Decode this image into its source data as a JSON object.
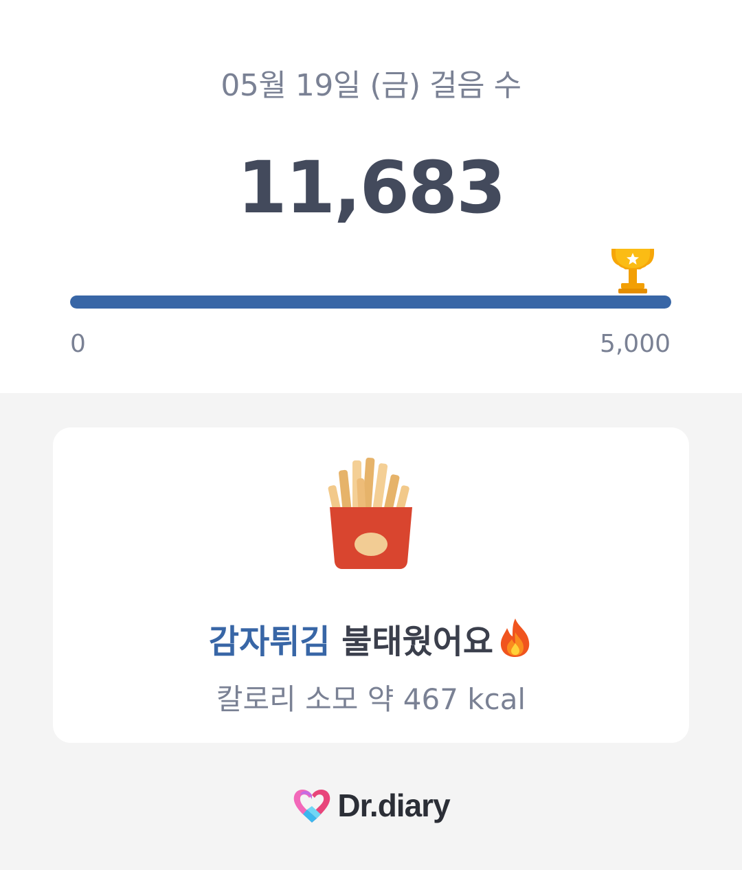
{
  "summary": {
    "date_title": "05월 19일 (금) 걸음 수",
    "steps": "11,683",
    "goal_progress": 1.0,
    "axis_min": "0",
    "axis_max": "5,000",
    "goal_icon": "trophy-icon",
    "progress_color": "#3866a6"
  },
  "burn_card": {
    "food_icon": "french-fries-icon",
    "food_name": "감자튀김",
    "burned_text": " 불태웠어요",
    "burned_icon": "fire-icon",
    "calories_text": "칼로리 소모 약 467 kcal",
    "accent_color": "#3866a6"
  },
  "footer": {
    "logo_icon": "heart-logo-icon",
    "brand_name": "Dr.diary"
  }
}
